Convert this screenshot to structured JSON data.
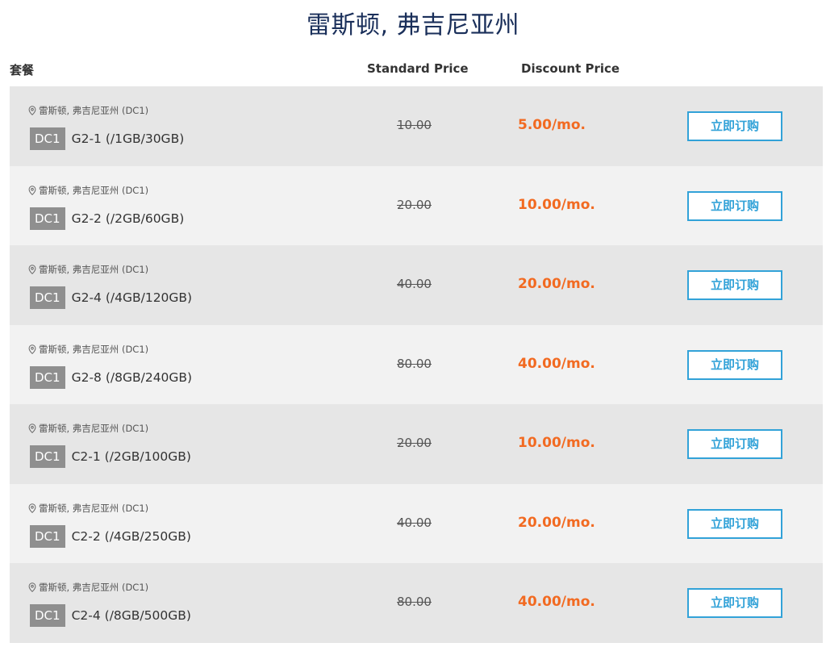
{
  "page": {
    "title": "雷斯顿, 弗吉尼亚州"
  },
  "header": {
    "package": "套餐",
    "standard_price": "Standard Price",
    "discount_price": "Discount Price"
  },
  "colors": {
    "title": "#1a2f5a",
    "discount": "#f26a21",
    "button": "#32a2d8",
    "badge": "#8f8f8f"
  },
  "icons": {
    "location": "map-pin-icon"
  },
  "plans": [
    {
      "location": "雷斯顿, 弗吉尼亚州 (DC1)",
      "badge": "DC1",
      "name": "G2-1 (/1GB/30GB)",
      "standard": "10.00",
      "discount": "5.00/mo.",
      "button": "立即订购"
    },
    {
      "location": "雷斯顿, 弗吉尼亚州 (DC1)",
      "badge": "DC1",
      "name": "G2-2 (/2GB/60GB)",
      "standard": "20.00",
      "discount": "10.00/mo.",
      "button": "立即订购"
    },
    {
      "location": "雷斯顿, 弗吉尼亚州 (DC1)",
      "badge": "DC1",
      "name": "G2-4 (/4GB/120GB)",
      "standard": "40.00",
      "discount": "20.00/mo.",
      "button": "立即订购"
    },
    {
      "location": "雷斯顿, 弗吉尼亚州 (DC1)",
      "badge": "DC1",
      "name": "G2-8 (/8GB/240GB)",
      "standard": "80.00",
      "discount": "40.00/mo.",
      "button": "立即订购"
    },
    {
      "location": "雷斯顿, 弗吉尼亚州 (DC1)",
      "badge": "DC1",
      "name": "C2-1 (/2GB/100GB)",
      "standard": "20.00",
      "discount": "10.00/mo.",
      "button": "立即订购"
    },
    {
      "location": "雷斯顿, 弗吉尼亚州 (DC1)",
      "badge": "DC1",
      "name": "C2-2 (/4GB/250GB)",
      "standard": "40.00",
      "discount": "20.00/mo.",
      "button": "立即订购"
    },
    {
      "location": "雷斯顿, 弗吉尼亚州 (DC1)",
      "badge": "DC1",
      "name": "C2-4 (/8GB/500GB)",
      "standard": "80.00",
      "discount": "40.00/mo.",
      "button": "立即订购"
    }
  ]
}
